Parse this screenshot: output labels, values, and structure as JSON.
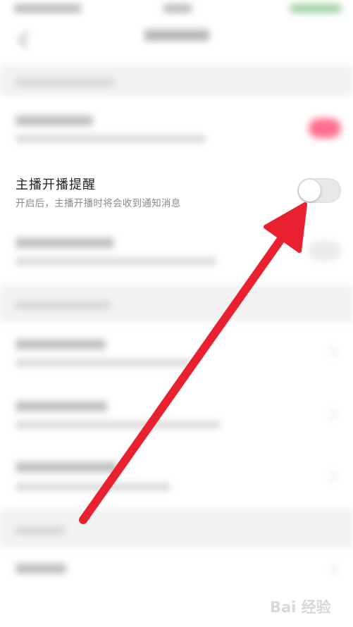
{
  "setting": {
    "title": "主播开播提醒",
    "description": "开启后，主播开播时将会收到通知消息",
    "toggle_on": false
  },
  "colors": {
    "arrow": "#e8202f",
    "toggle_off": "#e8e8e8",
    "blurred_toggle_on": "#ff6f8e",
    "section_background": "#f2f2f2"
  },
  "watermark": {
    "text": "Bai 经验"
  }
}
